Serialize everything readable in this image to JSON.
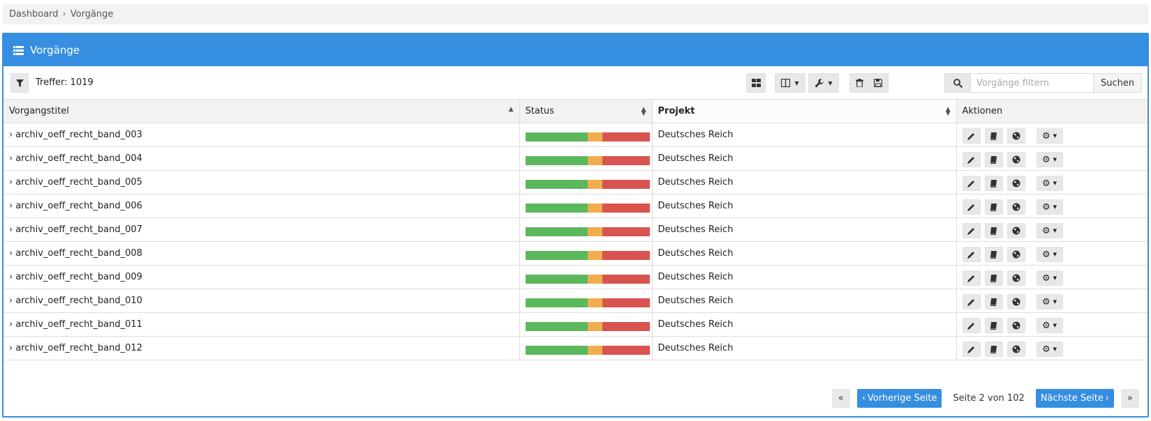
{
  "breadcrumb": {
    "items": [
      "Dashboard",
      "Vorgänge"
    ],
    "separator": "›"
  },
  "panel": {
    "title": "Vorgänge"
  },
  "toolbar": {
    "hits_label": "Treffer: 1019"
  },
  "search": {
    "placeholder": "Vorgänge filtern",
    "button_label": "Suchen"
  },
  "table": {
    "headers": {
      "title": "Vorgangstitel",
      "status": "Status",
      "project": "Projekt",
      "actions": "Aktionen"
    },
    "rows": [
      {
        "title": "archiv_oeff_recht_band_003",
        "project": "Deutsches Reich",
        "status": {
          "done": 0.5,
          "progress": 0.12,
          "open": 0.38
        }
      },
      {
        "title": "archiv_oeff_recht_band_004",
        "project": "Deutsches Reich",
        "status": {
          "done": 0.5,
          "progress": 0.12,
          "open": 0.38
        }
      },
      {
        "title": "archiv_oeff_recht_band_005",
        "project": "Deutsches Reich",
        "status": {
          "done": 0.5,
          "progress": 0.12,
          "open": 0.38
        }
      },
      {
        "title": "archiv_oeff_recht_band_006",
        "project": "Deutsches Reich",
        "status": {
          "done": 0.5,
          "progress": 0.12,
          "open": 0.38
        }
      },
      {
        "title": "archiv_oeff_recht_band_007",
        "project": "Deutsches Reich",
        "status": {
          "done": 0.5,
          "progress": 0.12,
          "open": 0.38
        }
      },
      {
        "title": "archiv_oeff_recht_band_008",
        "project": "Deutsches Reich",
        "status": {
          "done": 0.5,
          "progress": 0.12,
          "open": 0.38
        }
      },
      {
        "title": "archiv_oeff_recht_band_009",
        "project": "Deutsches Reich",
        "status": {
          "done": 0.5,
          "progress": 0.12,
          "open": 0.38
        }
      },
      {
        "title": "archiv_oeff_recht_band_010",
        "project": "Deutsches Reich",
        "status": {
          "done": 0.5,
          "progress": 0.12,
          "open": 0.38
        }
      },
      {
        "title": "archiv_oeff_recht_band_011",
        "project": "Deutsches Reich",
        "status": {
          "done": 0.5,
          "progress": 0.12,
          "open": 0.38
        }
      },
      {
        "title": "archiv_oeff_recht_band_012",
        "project": "Deutsches Reich",
        "status": {
          "done": 0.5,
          "progress": 0.12,
          "open": 0.38
        }
      }
    ]
  },
  "pagination": {
    "first_icon": "double-chevron-left-icon",
    "prev_label": "Vorherige Seite",
    "page_info": "Seite 2 von 102",
    "next_label": "Nächste Seite",
    "last_icon": "double-chevron-right-icon"
  },
  "colors": {
    "accent": "#368ee0",
    "done": "#5cb85c",
    "progress": "#f0ad4e",
    "open": "#d9534f"
  }
}
